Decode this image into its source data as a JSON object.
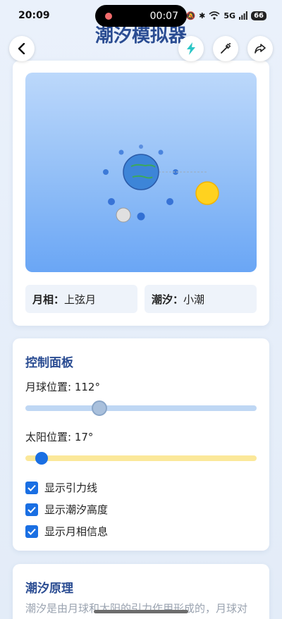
{
  "status_bar": {
    "time": "20:09",
    "battery": "66",
    "network": "5G",
    "recording_time": "00:07"
  },
  "header": {
    "title": "潮汐模拟器"
  },
  "simulation": {
    "moon_phase_label": "月相：",
    "moon_phase_value": "上弦月",
    "tide_label": "潮汐：",
    "tide_value": "小潮"
  },
  "controls": {
    "title": "控制面板",
    "moon_position_label": "月球位置: 112°",
    "moon_position_deg": 112,
    "sun_position_label": "太阳位置: 17°",
    "sun_position_deg": 17,
    "checkboxes": [
      {
        "label": "显示引力线",
        "checked": true
      },
      {
        "label": "显示潮汐高度",
        "checked": true
      },
      {
        "label": "显示月相信息",
        "checked": true
      }
    ]
  },
  "theory": {
    "title": "潮汐原理",
    "text": "潮汐是由月球和太阳的引力作用形成的，月球对"
  },
  "colors": {
    "accent": "#1a6fe3",
    "title": "#2a4c92",
    "sun": "#ffd21f",
    "earth": "#3d85d8"
  }
}
